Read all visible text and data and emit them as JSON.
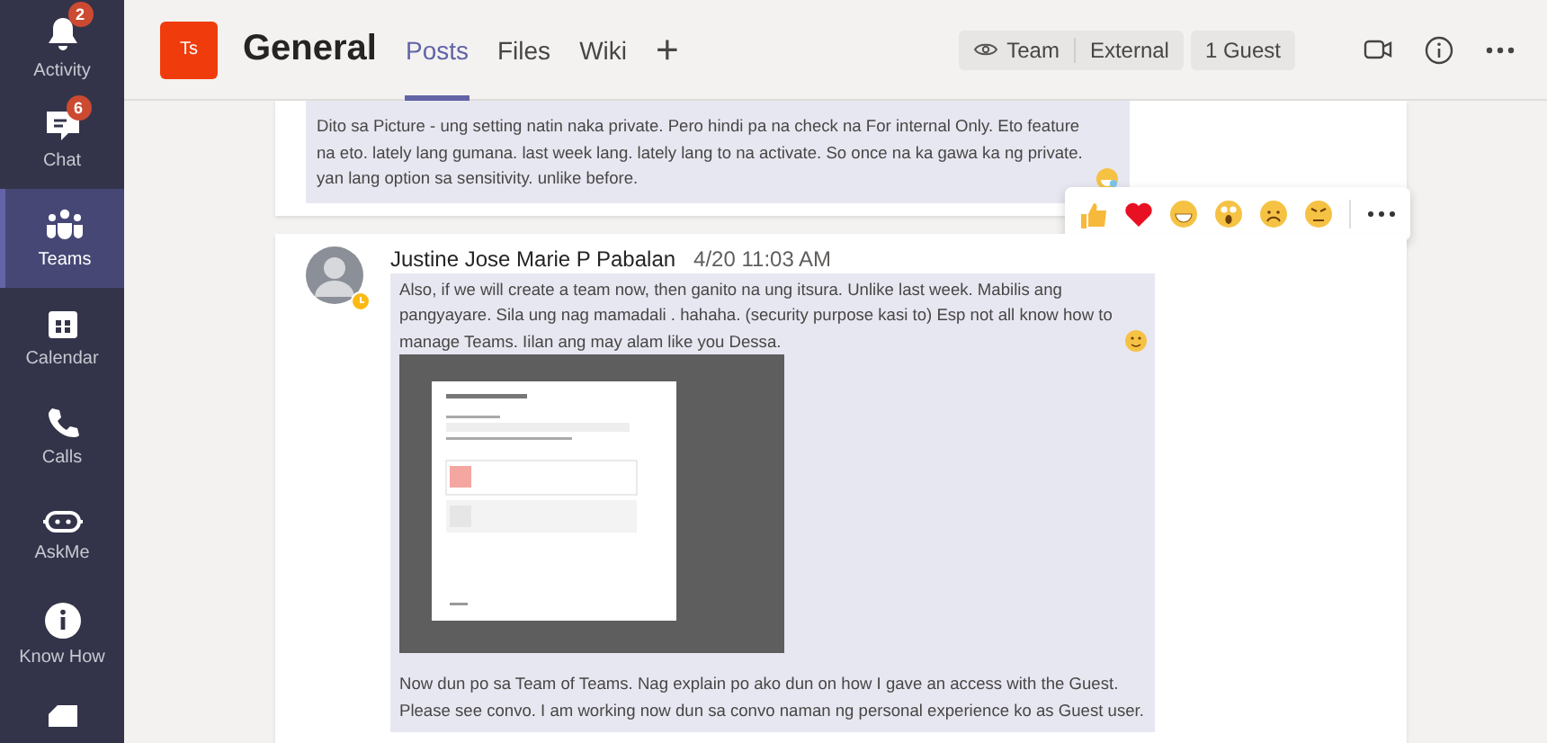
{
  "rail": [
    {
      "label": "Activity",
      "badge": "2",
      "selected": false
    },
    {
      "label": "Chat",
      "badge": "6",
      "selected": false
    },
    {
      "label": "Teams",
      "selected": true
    },
    {
      "label": "Calendar",
      "selected": false
    },
    {
      "label": "Calls",
      "selected": false
    },
    {
      "label": "AskMe",
      "selected": false
    },
    {
      "label": "Know How",
      "selected": false
    }
  ],
  "header": {
    "team_avatar": "Ts",
    "title": "General",
    "tabs": [
      {
        "label": "Posts",
        "selected": true
      },
      {
        "label": "Files",
        "selected": false
      },
      {
        "label": "Wiki",
        "selected": false
      }
    ],
    "add_tab": "+",
    "pills": [
      "Team",
      "External"
    ],
    "guests": "1 Guest"
  },
  "messages": [
    {
      "text": "Dito sa Picture - ung setting natin naka private. Pero hindi pa na check na For internal Only. Eto feature na eto. lately lang gumana. last week lang. lately lang to na activate. So once na ka gawa ka ng private. yan lang option sa sensitivity. unlike before."
    },
    {
      "author": "Justine Jose Marie P Pabalan",
      "time": "4/20 11:03 AM",
      "text": "Also, if we will create a team now, then ganito na ung itsura. Unlike last week. Mabilis ang pangyayare. Sila ung nag mamadali . hahaha. (security purpose kasi to) Esp not all know how to manage Teams. Iilan ang may alam like you Dessa.",
      "text_after": "Now dun po sa Team of Teams. Nag explain po ako dun on how I gave an access with the Guest. Please see convo. I am working now dun sa convo naman ng personal experience ko as Guest user."
    }
  ]
}
